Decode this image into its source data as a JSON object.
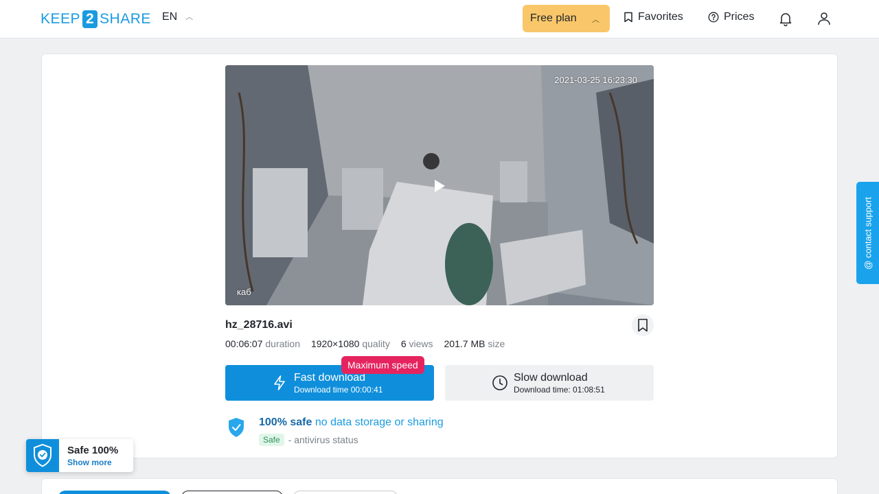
{
  "header": {
    "logo": {
      "left": "KEEP",
      "mid": "2",
      "right": "SHARE"
    },
    "language": "EN",
    "plan_label": "Free plan",
    "favorites_label": "Favorites",
    "prices_label": "Prices"
  },
  "video": {
    "timestamp": "2021-03-25 16:23:30",
    "corner_label": "каб"
  },
  "file": {
    "name": "hz_28716.avi",
    "duration": "00:06:07",
    "duration_label": "duration",
    "resolution": "1920×1080",
    "resolution_label": "quality",
    "views": "6",
    "views_label": "views",
    "size": "201.7 MB",
    "size_label": "size"
  },
  "downloads": {
    "fast_badge": "Maximum speed",
    "fast_title": "Fast download",
    "fast_sub": "Download time 00:00:41",
    "slow_title": "Slow download",
    "slow_sub": "Download time: 01:08:51"
  },
  "safety": {
    "strong": "100% safe",
    "rest": "no data storage or sharing",
    "pill": "Safe",
    "status": "- antivirus status"
  },
  "widget": {
    "title": "Safe 100%",
    "link": "Show more"
  },
  "support": {
    "label": "@ contact support"
  },
  "colors": {
    "accent": "#0f8fdb",
    "plan": "#f9c76a",
    "badge": "#e5245f"
  }
}
